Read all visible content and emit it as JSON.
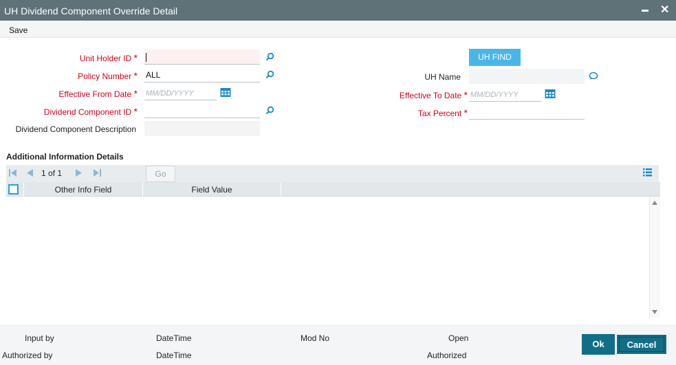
{
  "window": {
    "title": "UH Dividend Component Override Detail",
    "minimize_icon": "minimize-icon",
    "close_icon": "close-icon",
    "close_glyph": "✕"
  },
  "menu": {
    "save": "Save"
  },
  "form": {
    "unit_holder_id": {
      "label": "Unit Holder ID",
      "value": ""
    },
    "policy_number": {
      "label": "Policy Number",
      "value": "ALL"
    },
    "effective_from_date": {
      "label": "Effective From Date",
      "placeholder": "MM/DD/YYYY"
    },
    "dividend_component_id": {
      "label": "Dividend Component ID",
      "value": ""
    },
    "dividend_component_description": {
      "label": "Dividend Component Description",
      "value": ""
    },
    "uh_find": "UH FIND",
    "uh_name": {
      "label": "UH Name",
      "value": ""
    },
    "effective_to_date": {
      "label": "Effective To Date",
      "placeholder": "MM/DD/YYYY"
    },
    "tax_percent": {
      "label": "Tax Percent",
      "value": ""
    },
    "required_mark": "*"
  },
  "additional_info": {
    "title": "Additional Information Details",
    "pagination": {
      "current": "1",
      "of": "of",
      "total": "1",
      "go": "Go"
    },
    "columns": [
      "Other Info Field",
      "Field Value"
    ],
    "rows": []
  },
  "footer": {
    "input_by": "Input by",
    "authorized_by": "Authorized by",
    "datetime_1": "DateTime",
    "datetime_2": "DateTime",
    "mod_no": "Mod No",
    "open": "Open",
    "authorized": "Authorized",
    "ok": "Ok",
    "cancel": "Cancel"
  },
  "colors": {
    "titlebar": "#5e7278",
    "accent": "#2a9fd6",
    "required": "#d0021b",
    "button_primary": "#116e86",
    "button_find": "#4ab6e8"
  }
}
